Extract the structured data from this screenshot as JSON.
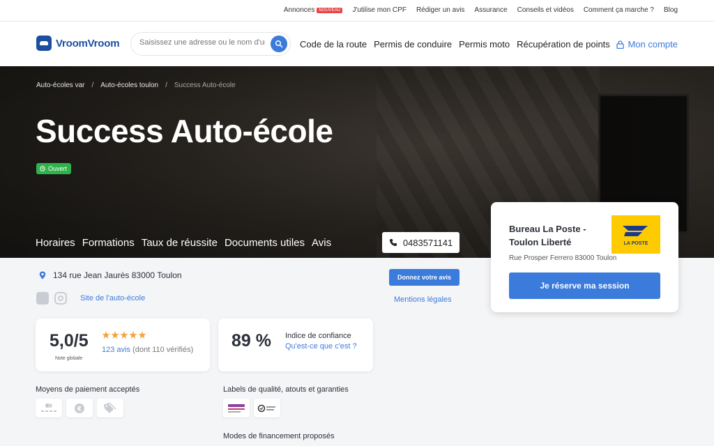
{
  "topbar": {
    "links": [
      "Annonces",
      "J'utilise mon CPF",
      "Rédiger un avis",
      "Assurance",
      "Conseils et vidéos",
      "Comment ça marche ?",
      "Blog"
    ],
    "new_badge": "NOUVEAU"
  },
  "header": {
    "logo_text": "VroomVroom",
    "search_placeholder": "Saisissez une adresse ou le nom d'une auto-école",
    "nav": [
      "Code de la route",
      "Permis de conduire",
      "Permis moto",
      "Récupération de points"
    ],
    "account_label": "Mon compte"
  },
  "hero": {
    "breadcrumb": [
      "Auto-écoles var",
      "Auto-écoles toulon",
      "Success Auto-école"
    ],
    "title": "Success Auto-école",
    "status": "Ouvert",
    "tabs": [
      "Horaires",
      "Formations",
      "Taux de réussite",
      "Documents utiles",
      "Avis"
    ],
    "phone": "0483571141"
  },
  "info": {
    "address": "134 rue Jean Jaurès 83000 Toulon",
    "site_link": "Site de l'auto-école",
    "review_button": "Donnez votre avis",
    "legal_link": "Mentions légales"
  },
  "rating": {
    "score": "5,0/5",
    "score_label": "Note globale",
    "stars": 5,
    "count": "123 avis",
    "verified": "(dont 110 vérifiés)"
  },
  "trust": {
    "percent": "89 %",
    "label": "Indice de confiance",
    "question": "Qu'est-ce que c'est ?"
  },
  "sections": {
    "payment_title": "Moyens de paiement acceptés",
    "labels_title": "Labels de qualité, atouts et garanties",
    "financing_title": "Modes de financement proposés"
  },
  "booking": {
    "name": "Bureau La Poste - Toulon Liberté",
    "logo_text": "LA POSTE",
    "address": "Rue Prosper Ferrero 83000 Toulon",
    "button": "Je réserve ma session"
  },
  "colors": {
    "accent": "#3b7bdb",
    "brand": "#1d4fa0",
    "open": "#2fb24a",
    "star": "#f2a23a",
    "laposte": "#fecb00"
  }
}
